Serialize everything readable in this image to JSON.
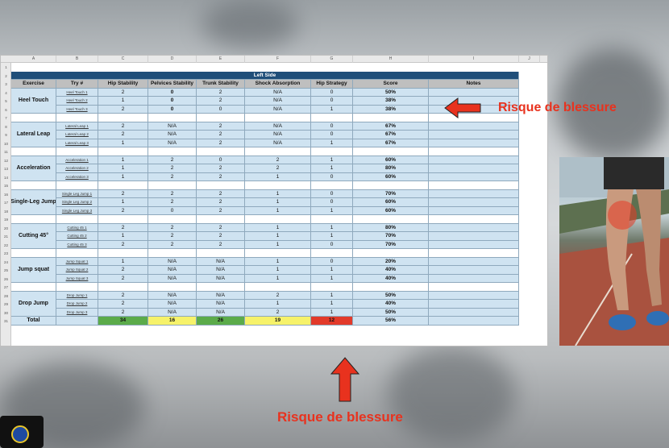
{
  "sheet": {
    "col_letters": [
      "A",
      "B",
      "C",
      "D",
      "E",
      "F",
      "G",
      "H",
      "I",
      "J"
    ],
    "row_numbers": [
      "1",
      "2",
      "3",
      "4",
      "5",
      "6",
      "7",
      "8",
      "9",
      "10",
      "11",
      "12",
      "13",
      "14",
      "15",
      "16",
      "17",
      "18",
      "19",
      "20",
      "21",
      "22",
      "23",
      "24",
      "25",
      "26",
      "27",
      "28",
      "29",
      "30",
      "31"
    ],
    "title": "Left Side",
    "headers": [
      "Exercise",
      "Try #",
      "Hip Stability",
      "Pelvices Stability",
      "Trunk Stability",
      "Shock Absorption",
      "Hip Strategy",
      "Score",
      "Notes"
    ],
    "groups": [
      {
        "exercise": "Heel Touch",
        "rows": [
          {
            "try": "Heel Touch 1",
            "v": [
              "2",
              "0",
              "2",
              "N/A",
              "0",
              "50%"
            ]
          },
          {
            "try": "Heel Touch 2",
            "v": [
              "1",
              "0",
              "2",
              "N/A",
              "0",
              "38%"
            ]
          },
          {
            "try": "Heel Touch 3",
            "v": [
              "2",
              "0",
              "0",
              "N/A",
              "1",
              "38%"
            ]
          }
        ]
      },
      {
        "exercise": "Lateral Leap",
        "rows": [
          {
            "try": "Lateral Leap 1",
            "v": [
              "2",
              "N/A",
              "2",
              "N/A",
              "0",
              "67%"
            ]
          },
          {
            "try": "Lateral Leap 2",
            "v": [
              "2",
              "N/A",
              "2",
              "N/A",
              "0",
              "67%"
            ]
          },
          {
            "try": "Lateral Leap 3",
            "v": [
              "1",
              "N/A",
              "2",
              "N/A",
              "1",
              "67%"
            ]
          }
        ]
      },
      {
        "exercise": "Acceleration",
        "rows": [
          {
            "try": "Acceleration 1",
            "v": [
              "1",
              "2",
              "0",
              "2",
              "1",
              "60%"
            ]
          },
          {
            "try": "Acceleration 2",
            "v": [
              "1",
              "2",
              "2",
              "2",
              "1",
              "80%"
            ]
          },
          {
            "try": "Acceleration 3",
            "v": [
              "1",
              "2",
              "2",
              "1",
              "0",
              "60%"
            ]
          }
        ]
      },
      {
        "exercise": "Single-Leg Jump",
        "rows": [
          {
            "try": "Single Leg Jump 1",
            "v": [
              "2",
              "2",
              "2",
              "1",
              "0",
              "70%"
            ]
          },
          {
            "try": "Single Leg Jump 2",
            "v": [
              "1",
              "2",
              "2",
              "1",
              "0",
              "60%"
            ]
          },
          {
            "try": "Single Leg Jump 3",
            "v": [
              "2",
              "0",
              "2",
              "1",
              "1",
              "60%"
            ]
          }
        ]
      },
      {
        "exercise": "Cutting 45°",
        "rows": [
          {
            "try": "Cutting 45 1",
            "v": [
              "2",
              "2",
              "2",
              "1",
              "1",
              "80%"
            ]
          },
          {
            "try": "Cutting 45 2",
            "v": [
              "1",
              "2",
              "2",
              "1",
              "1",
              "70%"
            ]
          },
          {
            "try": "Cutting 45 3",
            "v": [
              "2",
              "2",
              "2",
              "1",
              "0",
              "70%"
            ]
          }
        ]
      },
      {
        "exercise": "Jump squat",
        "rows": [
          {
            "try": "Jump Squat 1",
            "v": [
              "1",
              "N/A",
              "N/A",
              "1",
              "0",
              "20%"
            ]
          },
          {
            "try": "Jump Squat 2",
            "v": [
              "2",
              "N/A",
              "N/A",
              "1",
              "1",
              "40%"
            ]
          },
          {
            "try": "Jump Squat 3",
            "v": [
              "2",
              "N/A",
              "N/A",
              "1",
              "1",
              "40%"
            ]
          }
        ]
      },
      {
        "exercise": "Drop Jump",
        "rows": [
          {
            "try": "Drop Jump 1",
            "v": [
              "2",
              "N/A",
              "N/A",
              "2",
              "1",
              "50%"
            ]
          },
          {
            "try": "Drop Jump 2",
            "v": [
              "2",
              "N/A",
              "N/A",
              "1",
              "1",
              "40%"
            ]
          },
          {
            "try": "Drop Jump 3",
            "v": [
              "2",
              "N/A",
              "N/A",
              "2",
              "1",
              "50%"
            ]
          }
        ]
      }
    ],
    "total": {
      "label": "Total",
      "v": [
        "34",
        "16",
        "26",
        "19",
        "12",
        "56%"
      ]
    }
  },
  "annotations": {
    "right_label": "Risque de blessure",
    "bottom_label": "Risque de blessure"
  },
  "colors": {
    "accent_red": "#e8321e",
    "title_blue": "#1f4e79",
    "green": "#5bab4a",
    "yellow": "#f6f26a",
    "red": "#e23a2a"
  },
  "photo": {
    "icon": "knee-pain-photo"
  }
}
